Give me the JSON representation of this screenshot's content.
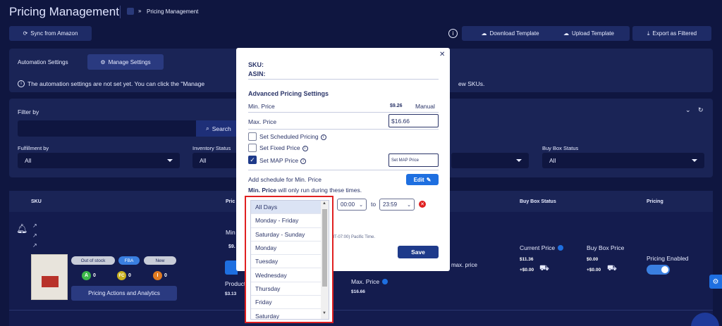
{
  "header": {
    "title": "Pricing Management",
    "breadcrumb_sep": "»",
    "breadcrumb": "Pricing Management"
  },
  "toolbar": {
    "sync": "Sync from Amazon",
    "download": "Download Template",
    "upload": "Upload Template",
    "export": "Export as Filtered"
  },
  "automation": {
    "label": "Automation Settings",
    "manage": "Manage Settings",
    "notice_left": "The automation settings are not set yet. You can click the \"Manage",
    "notice_right": "ew SKUs."
  },
  "filter": {
    "label": "Filter by",
    "search_button": "Search",
    "fulfillment_label": "Fulfillment by",
    "fulfillment_value": "All",
    "inventory_label": "Inventory Status",
    "inventory_value": "All",
    "buybox_label": "Buy Box Status",
    "buybox_value": "All"
  },
  "table": {
    "headers": {
      "sku": "SKU",
      "price_partial": "Pric",
      "buybox_status": "Buy Box Status",
      "pricing": "Pricing"
    },
    "row": {
      "badges": [
        "Out of stock",
        "FBA",
        "New"
      ],
      "counts": [
        {
          "letter": "A",
          "value": "0"
        },
        {
          "letter": "FC",
          "value": "0"
        },
        {
          "letter": "I",
          "value": "0"
        }
      ],
      "actions_button": "Pricing Actions and Analytics",
      "min_partial": "Min",
      "min_val_partial": "$9.",
      "product_partial": "Product",
      "product_val": "$3.13",
      "max_label_partial": "max. price",
      "max_price_label": "Max. Price",
      "max_price_val": "$16.66",
      "current_price_label": "Current Price",
      "current_price_val": "$11.36",
      "current_price_ship": "+$0.00",
      "buybox_price_label": "Buy Box Price",
      "buybox_price_val": "$0.00",
      "buybox_price_ship": "+$0.00",
      "pricing_enabled": "Pricing Enabled"
    }
  },
  "modal": {
    "sku_label": "SKU:",
    "asin_label": "ASIN:",
    "section_title": "Advanced Pricing Settings",
    "min_label": "Min. Price",
    "min_value": "$9.26",
    "min_mode": "Manual",
    "max_label": "Max. Price",
    "max_value": "$16.66",
    "opt_scheduled": "Set Scheduled Pricing",
    "opt_fixed": "Set Fixed Price",
    "opt_map": "Set MAP Price",
    "map_input_placeholder": "Set MAP Price",
    "schedule_title": "Add schedule for Min. Price",
    "edit_button": "Edit",
    "schedule_note_bold": "Min. Price",
    "schedule_note_rest": " will only run during these times.",
    "time_from": "00:00",
    "time_to_word": "to",
    "time_to": "23:59",
    "tz_note": "MT-07:00) Pacific Time.",
    "save_button": "Save"
  },
  "dropdown": {
    "options": [
      "All Days",
      "Monday - Friday",
      "Saturday - Sunday",
      "Monday",
      "Tuesday",
      "Wednesday",
      "Thursday",
      "Friday",
      "Saturday"
    ],
    "selected": "All Days"
  },
  "colors": {
    "bg": "#0f1640",
    "panel": "#1a2456",
    "accent": "#1e6fe0",
    "highlight": "#e02020",
    "modal_text": "#2a3468"
  }
}
